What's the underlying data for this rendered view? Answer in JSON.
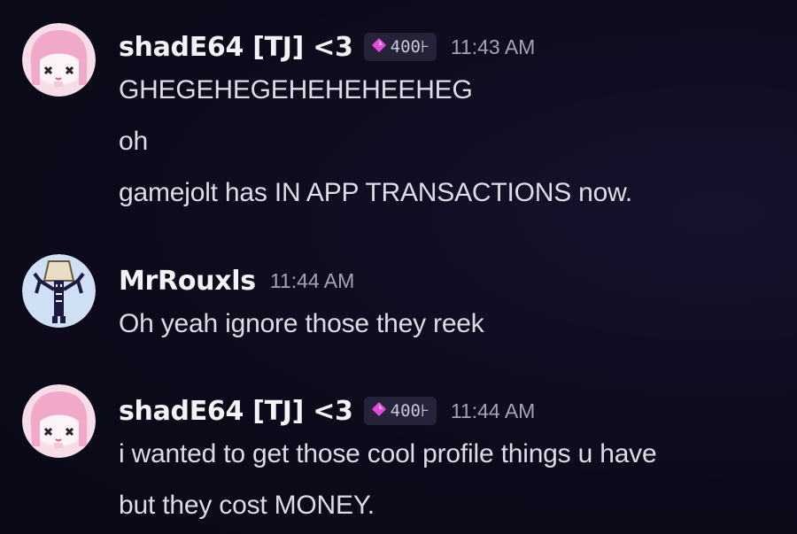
{
  "messages": [
    {
      "author": "shadE64 [TJ] <3",
      "avatar": "pink-hair-character-avatar",
      "badge": {
        "icon": "pink-gem-icon",
        "text": "400⊦"
      },
      "timestamp": "11:43 AM",
      "lines": [
        "GHEGEHEGEHEHEHEEHEG",
        "oh",
        "gamejolt has IN APP TRANSACTIONS now."
      ]
    },
    {
      "author": "MrRouxls",
      "avatar": "pixel-lamp-character-avatar",
      "timestamp": "11:44 AM",
      "lines": [
        "Oh yeah ignore those they reek"
      ]
    },
    {
      "author": "shadE64 [TJ] <3",
      "avatar": "pink-hair-character-avatar",
      "badge": {
        "icon": "pink-gem-icon",
        "text": "400⊦"
      },
      "timestamp": "11:44 AM",
      "lines": [
        "i wanted to get those cool profile things u have",
        "but they cost MONEY."
      ]
    }
  ],
  "colors": {
    "background": "#0d0b1c",
    "username": "#f2f3f5",
    "text": "#dcdde4",
    "timestamp": "#a2a4b5",
    "badge_bg": "#24233a",
    "gem": "#e24cd8"
  }
}
